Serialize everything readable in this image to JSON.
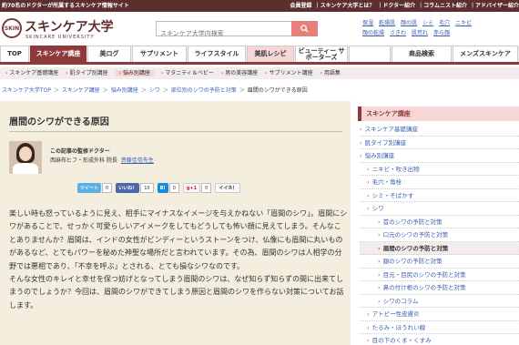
{
  "topbar": {
    "tagline": "約70名のドクターが所属するスキンケア情報サイト",
    "links": [
      "会員登録",
      "｜スキンケア大学とは？",
      "｜ドクター紹介",
      "｜コラムニスト紹介",
      "｜アドバイザー紹介"
    ]
  },
  "header": {
    "logo_mark": "SKIN",
    "logo_text": "スキンケア大学",
    "logo_sub": "SKINCARE UNIVERSITY",
    "search_placeholder": "スキンケア大学内検索",
    "links": [
      "保湿",
      "乾燥肌",
      "顔の肌",
      "シミ",
      "毛穴",
      "ニキビ",
      "顔の乾燥",
      "さきわ",
      "肌荒れ",
      "赤ら顔"
    ]
  },
  "gnav": [
    {
      "label": "TOP",
      "style": "normal"
    },
    {
      "label": "スキンケア講座",
      "style": "active"
    },
    {
      "label": "美ログ",
      "style": "normal"
    },
    {
      "label": "サプリメント",
      "style": "normal"
    },
    {
      "label": "ライフスタイル",
      "style": "normal"
    },
    {
      "label": "美肌レシピ",
      "style": "pink"
    },
    {
      "label": "ビューティー サポーターズ",
      "style": "normal"
    },
    {
      "label": "",
      "style": "normal"
    },
    {
      "label": "商品検索",
      "style": "normal"
    },
    {
      "label": "メンズスキンケア",
      "style": "normal"
    }
  ],
  "subnav": [
    {
      "label": "スキンケア基礎講座",
      "active": false
    },
    {
      "label": "肌タイプ別講座",
      "active": false
    },
    {
      "label": "悩み別講座",
      "active": true
    },
    {
      "label": "マタニティ＆ベビー",
      "active": false
    },
    {
      "label": "男の美容講座",
      "active": false
    },
    {
      "label": "サプリメント講座",
      "active": false
    },
    {
      "label": "用語集",
      "active": false
    }
  ],
  "breadcrumbs": [
    "スキンケア大学TOP",
    "スキンケア講座",
    "悩み別講座",
    "シワ",
    "部位別のシワの予防と対策",
    "眉間のシワができる原因"
  ],
  "article": {
    "title": "眉間のシワができる原因",
    "supervisor_label": "この記事の監修ドクター",
    "supervisor_name": "西麻布ヒフ・形成外科 院長",
    "supervisor_link": "斉藤佳信先生",
    "share": {
      "tweet": "ツイート",
      "tweet_count": "0",
      "like": "いいね！",
      "like_count": "10",
      "hatena": "B!",
      "hatena_count": "0",
      "gplus": "g+1",
      "gplus_count": "0",
      "pocket": "イイネ！"
    },
    "paragraphs": [
      "楽しい時も怒っているように見え、相手にマイナスなイメージを与えかねない「眉間のシワ」。眉間にシワがあることで、せっかく可愛らしいアイメークをしてもどうしても怖い顔に見えてしまう。そんなことありませんか？眉間は、インドの女性がビンディーというストーンをつけ、仏像にも眉間に丸いものがあるなど、とてもパワーを秘めた神聖な場所だと言われています。その為、眉間のシワは人相学の分野では悪相であり、「不幸を呼ぶ」とされる、とても損なシワなのです。",
      "そんな女性のキレイと幸せを保つ妨げとなってしまう眉間のシワは、なぜ知らず知らずの間に出来てしまうのでしょうか？今回は、眉間のシワができてしまう原因と眉間のシワを作らない対策についてお話します。"
    ]
  },
  "sidebar": {
    "heading": "スキンケア講座",
    "items": [
      {
        "label": "スキンケア基礎講座",
        "level": 1,
        "current": false
      },
      {
        "label": "肌タイプ別講座",
        "level": 1,
        "current": false
      },
      {
        "label": "悩み別講座",
        "level": 1,
        "current": false
      },
      {
        "label": "ニキビ・吹き出物",
        "level": 2,
        "current": false
      },
      {
        "label": "毛穴・角栓",
        "level": 2,
        "current": false
      },
      {
        "label": "シミ・そばかす",
        "level": 2,
        "current": false
      },
      {
        "label": "シワ",
        "level": 2,
        "current": false
      },
      {
        "label": "首のシワの予防と対策",
        "level": 3,
        "current": false
      },
      {
        "label": "口元のシワの予防と対策",
        "level": 3,
        "current": false
      },
      {
        "label": "眉間のシワの予防と対策",
        "level": 3,
        "current": true
      },
      {
        "label": "額のシワの予防と対策",
        "level": 3,
        "current": false
      },
      {
        "label": "目元・目尻のシワの予防と対策",
        "level": 3,
        "current": false
      },
      {
        "label": "鼻の付け根のシワの予防と対策",
        "level": 3,
        "current": false
      },
      {
        "label": "シワのコラム",
        "level": 3,
        "current": false
      },
      {
        "label": "アトピー性皮膚炎",
        "level": 2,
        "current": false
      },
      {
        "label": "たるみ・ほうれい線",
        "level": 2,
        "current": false
      },
      {
        "label": "目の下のくま・くすみ",
        "level": 2,
        "current": false
      }
    ]
  },
  "colors": {
    "brand": "#5c2e2e",
    "accent": "#8f3a3a",
    "pink": "#f6d6d6",
    "link": "#3a5fb0",
    "article_bg": "#f4eede"
  }
}
